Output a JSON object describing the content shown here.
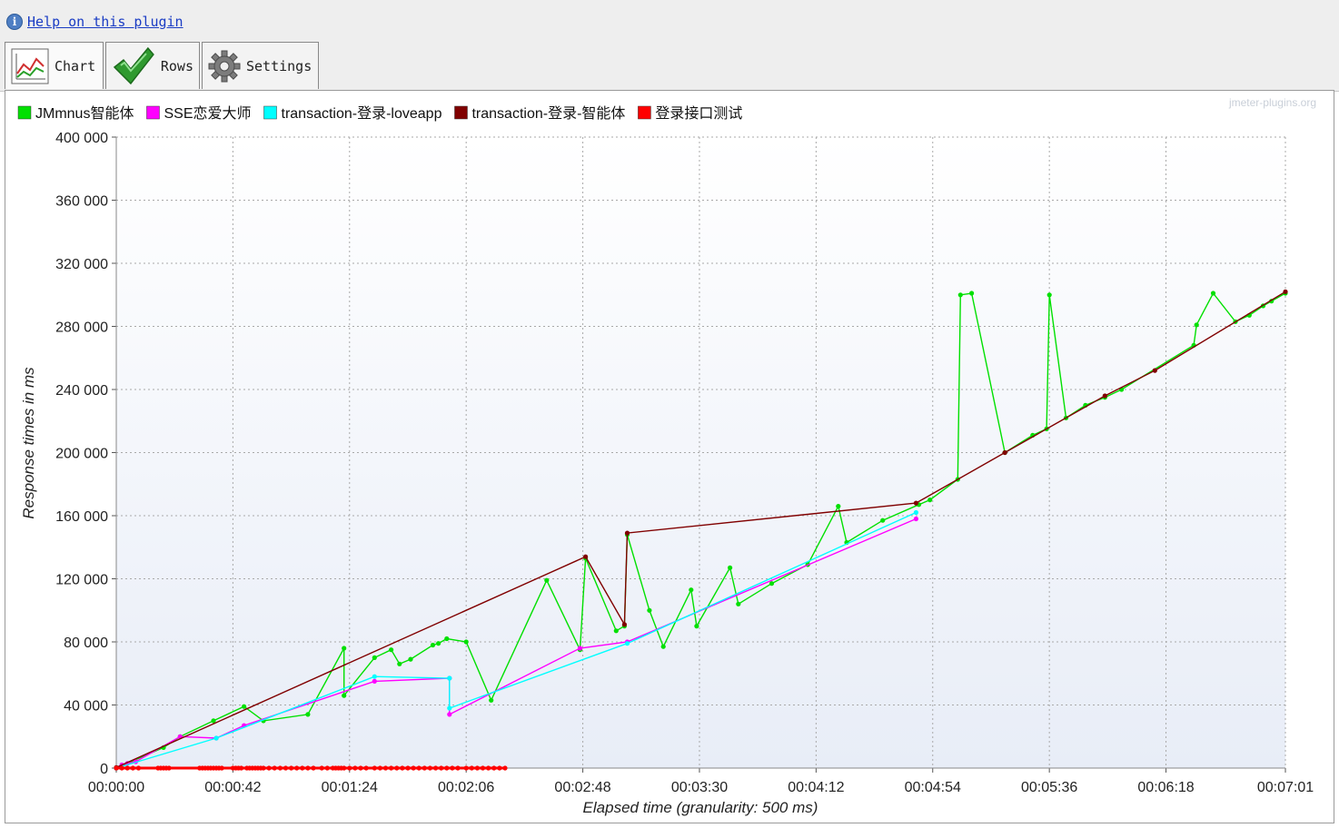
{
  "help": {
    "label": "Help on this plugin",
    "icon": "info-icon"
  },
  "tabs": [
    {
      "label": "Chart",
      "icon": "line-chart-icon"
    },
    {
      "label": "Rows",
      "icon": "checkmark-icon"
    },
    {
      "label": "Settings",
      "icon": "gear-icon"
    }
  ],
  "watermark": "jmeter-plugins.org",
  "chart_data": {
    "type": "line",
    "xlabel": "Elapsed time (granularity: 500 ms)",
    "ylabel": "Response times in ms",
    "xlim": [
      0,
      421
    ],
    "ylim": [
      0,
      400000
    ],
    "x_unit": "seconds",
    "yticks": [
      "0",
      "40 000",
      "80 000",
      "120 000",
      "160 000",
      "200 000",
      "240 000",
      "280 000",
      "320 000",
      "360 000",
      "400 000"
    ],
    "yticks_values": [
      0,
      40000,
      80000,
      120000,
      160000,
      200000,
      240000,
      280000,
      320000,
      360000,
      400000
    ],
    "xticks": [
      "00:00:00",
      "00:00:42",
      "00:01:24",
      "00:02:06",
      "00:02:48",
      "00:03:30",
      "00:04:12",
      "00:04:54",
      "00:05:36",
      "00:06:18",
      "00:07:01"
    ],
    "xticks_values": [
      0,
      42,
      84,
      126,
      168,
      210,
      252,
      294,
      336,
      378,
      421
    ],
    "grid": true,
    "legend_position": "top-left",
    "background": "#e8edf7",
    "series": [
      {
        "name": "JMmnus智能体",
        "color": "#00e000",
        "points": [
          [
            0,
            0
          ],
          [
            17,
            13000
          ],
          [
            23,
            20000
          ],
          [
            35,
            30000
          ],
          [
            46,
            39000
          ],
          [
            53,
            30000
          ],
          [
            69,
            34000
          ],
          [
            82,
            76000
          ],
          [
            82,
            46000
          ],
          [
            93,
            70000
          ],
          [
            99,
            75000
          ],
          [
            102,
            66000
          ],
          [
            106,
            69000
          ],
          [
            114,
            78000
          ],
          [
            116,
            79000
          ],
          [
            119,
            82000
          ],
          [
            126,
            80000
          ],
          [
            135,
            43000
          ],
          [
            155,
            119000
          ],
          [
            167,
            75000
          ],
          [
            169,
            133000
          ],
          [
            180,
            87000
          ],
          [
            183,
            90000
          ],
          [
            184,
            148000
          ],
          [
            192,
            100000
          ],
          [
            197,
            77000
          ],
          [
            207,
            113000
          ],
          [
            209,
            90000
          ],
          [
            221,
            127000
          ],
          [
            224,
            104000
          ],
          [
            236,
            117000
          ],
          [
            249,
            129000
          ],
          [
            260,
            166000
          ],
          [
            263,
            143000
          ],
          [
            276,
            157000
          ],
          [
            289,
            167000
          ],
          [
            293,
            170000
          ],
          [
            303,
            183000
          ],
          [
            304,
            300000
          ],
          [
            308,
            301000
          ],
          [
            320,
            200000
          ],
          [
            330,
            211000
          ],
          [
            335,
            215000
          ],
          [
            336,
            300000
          ],
          [
            342,
            222000
          ],
          [
            349,
            230000
          ],
          [
            356,
            235000
          ],
          [
            362,
            240000
          ],
          [
            388,
            268000
          ],
          [
            389,
            281000
          ],
          [
            395,
            301000
          ],
          [
            403,
            283000
          ],
          [
            408,
            287000
          ],
          [
            413,
            293000
          ],
          [
            416,
            296000
          ],
          [
            421,
            301000
          ]
        ]
      },
      {
        "name": "SSE恋爱大师",
        "color": "#ff00ff",
        "points": [
          [
            0,
            0
          ],
          [
            2,
            2000
          ],
          [
            4,
            3000
          ],
          [
            7,
            4000
          ],
          [
            23,
            20000
          ],
          [
            36,
            19000
          ],
          [
            46,
            27000
          ],
          [
            93,
            55000
          ],
          [
            120,
            57000
          ],
          [
            120,
            34000
          ],
          [
            167,
            76000
          ],
          [
            184,
            80000
          ],
          [
            288,
            158000
          ]
        ]
      },
      {
        "name": "transaction-登录-loveapp",
        "color": "#00ffff",
        "points": [
          [
            0,
            0
          ],
          [
            36,
            19000
          ],
          [
            93,
            58000
          ],
          [
            120,
            57000
          ],
          [
            120,
            38000
          ],
          [
            184,
            79000
          ],
          [
            288,
            162000
          ]
        ]
      },
      {
        "name": "transaction-登录-智能体",
        "color": "#800000",
        "points": [
          [
            0,
            0
          ],
          [
            0,
            400
          ],
          [
            169,
            134000
          ],
          [
            183,
            91000
          ],
          [
            184,
            149000
          ],
          [
            288,
            168000
          ],
          [
            320,
            200000
          ],
          [
            356,
            236000
          ],
          [
            374,
            252000
          ],
          [
            421,
            302000
          ]
        ]
      },
      {
        "name": "登录接口测试",
        "color": "#ff0000",
        "points": [
          [
            0,
            0
          ],
          [
            2,
            0
          ],
          [
            4,
            0
          ],
          [
            6,
            0
          ],
          [
            8,
            0
          ],
          [
            15,
            0
          ],
          [
            16,
            0
          ],
          [
            17,
            0
          ],
          [
            18,
            0
          ],
          [
            19,
            0
          ],
          [
            30,
            0
          ],
          [
            31,
            0
          ],
          [
            32,
            0
          ],
          [
            33,
            0
          ],
          [
            34,
            0
          ],
          [
            35,
            0
          ],
          [
            36,
            0
          ],
          [
            37,
            0
          ],
          [
            38,
            0
          ],
          [
            42,
            0
          ],
          [
            43,
            0
          ],
          [
            44,
            0
          ],
          [
            45,
            0
          ],
          [
            47,
            0
          ],
          [
            48,
            0
          ],
          [
            49,
            0
          ],
          [
            50,
            0
          ],
          [
            51,
            0
          ],
          [
            52,
            0
          ],
          [
            53,
            0
          ],
          [
            55,
            0
          ],
          [
            57,
            0
          ],
          [
            59,
            0
          ],
          [
            61,
            0
          ],
          [
            63,
            0
          ],
          [
            65,
            0
          ],
          [
            67,
            0
          ],
          [
            69,
            0
          ],
          [
            71,
            0
          ],
          [
            74,
            0
          ],
          [
            76,
            0
          ],
          [
            78,
            0
          ],
          [
            79,
            0
          ],
          [
            80,
            0
          ],
          [
            81,
            0
          ],
          [
            82,
            0
          ],
          [
            84,
            0
          ],
          [
            86,
            0
          ],
          [
            88,
            0
          ],
          [
            90,
            0
          ],
          [
            93,
            0
          ],
          [
            95,
            0
          ],
          [
            97,
            0
          ],
          [
            99,
            0
          ],
          [
            101,
            0
          ],
          [
            103,
            0
          ],
          [
            105,
            0
          ],
          [
            107,
            0
          ],
          [
            109,
            0
          ],
          [
            111,
            0
          ],
          [
            113,
            0
          ],
          [
            115,
            0
          ],
          [
            117,
            0
          ],
          [
            119,
            0
          ],
          [
            121,
            0
          ],
          [
            123,
            0
          ],
          [
            126,
            0
          ],
          [
            128,
            0
          ],
          [
            130,
            0
          ],
          [
            132,
            0
          ],
          [
            134,
            0
          ],
          [
            136,
            0
          ],
          [
            138,
            0
          ],
          [
            140,
            0
          ]
        ]
      }
    ]
  }
}
